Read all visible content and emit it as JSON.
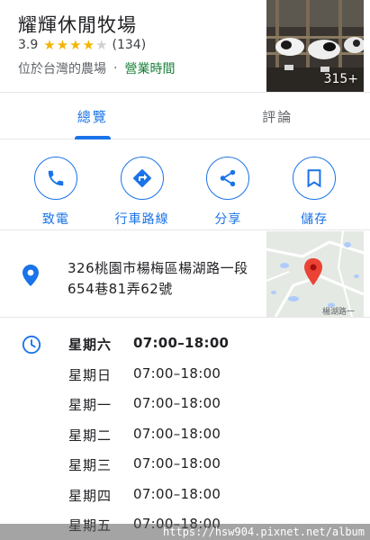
{
  "place": {
    "name": "耀輝休閒牧場",
    "rating": "3.9",
    "stars_filled": 4,
    "stars_total": 5,
    "review_count": "(134)",
    "category": "位於台灣的農場",
    "separator": "·",
    "hours_link": "營業時間",
    "photo_count": "315+"
  },
  "tabs": [
    {
      "label": "總覽",
      "active": true
    },
    {
      "label": "評論",
      "active": false
    }
  ],
  "actions": [
    {
      "label": "致電",
      "icon": "phone-icon"
    },
    {
      "label": "行車路線",
      "icon": "directions-icon"
    },
    {
      "label": "分享",
      "icon": "share-icon"
    },
    {
      "label": "儲存",
      "icon": "bookmark-icon"
    }
  ],
  "address": {
    "line1": "326桃園市楊梅區楊湖路一段",
    "line2": "654巷81弄62號",
    "map_label": "楊湖路一"
  },
  "hours": [
    {
      "day": "星期六",
      "time": "07:00–18:00",
      "today": true
    },
    {
      "day": "星期日",
      "time": "07:00–18:00",
      "today": false
    },
    {
      "day": "星期一",
      "time": "07:00–18:00",
      "today": false
    },
    {
      "day": "星期二",
      "time": "07:00–18:00",
      "today": false
    },
    {
      "day": "星期三",
      "time": "07:00–18:00",
      "today": false
    },
    {
      "day": "星期四",
      "time": "07:00–18:00",
      "today": false
    },
    {
      "day": "星期五",
      "time": "07:00–18:00",
      "today": false
    }
  ],
  "watermark": "https://hsw904.pixnet.net/album",
  "colors": {
    "accent": "#1a73e8",
    "open": "#188038",
    "star": "#f5b400",
    "pin": "#ea4335"
  }
}
